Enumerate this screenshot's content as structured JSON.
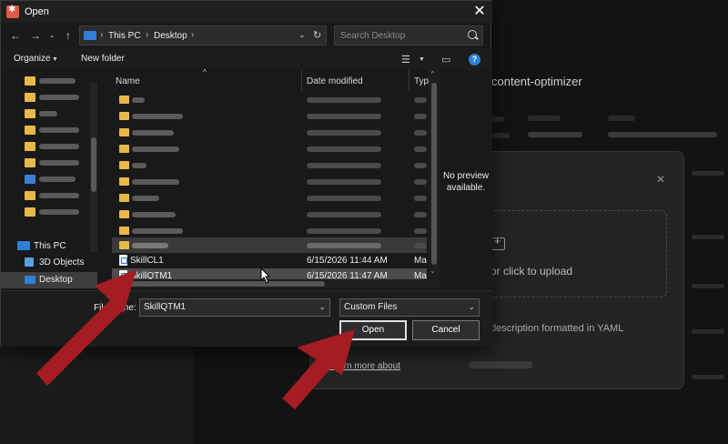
{
  "background_app": {
    "title": "content-optimizer",
    "modal": {
      "upload_text": "or click to upload",
      "hint": "description formatted in YAML",
      "link": "Learn more about"
    }
  },
  "dialog": {
    "title": "Open",
    "breadcrumb": [
      "This PC",
      "Desktop"
    ],
    "search_placeholder": "Search Desktop",
    "toolbar": {
      "organize": "Organize",
      "new_folder": "New folder"
    },
    "nav_pane": {
      "this_pc": "This PC",
      "objects_3d": "3D Objects",
      "desktop": "Desktop"
    },
    "columns": {
      "name": "Name",
      "date": "Date modified",
      "type": "Typ"
    },
    "files": [
      {
        "name": "SkillCL1",
        "date": "6/15/2026 11:44 AM",
        "type": "Ma"
      },
      {
        "name": "SkillQTM1",
        "date": "6/15/2026 11:47 AM",
        "type": "Ma"
      }
    ],
    "preview": {
      "line1": "No preview",
      "line2": "available."
    },
    "file_name_label": "File name:",
    "file_name_value": "SkillQTM1",
    "file_type": "Custom Files",
    "open_button": "Open",
    "cancel_button": "Cancel"
  },
  "colors": {
    "accent": "#2f7fd4",
    "folder": "#e8b84a",
    "arrow": "#a31d22"
  }
}
